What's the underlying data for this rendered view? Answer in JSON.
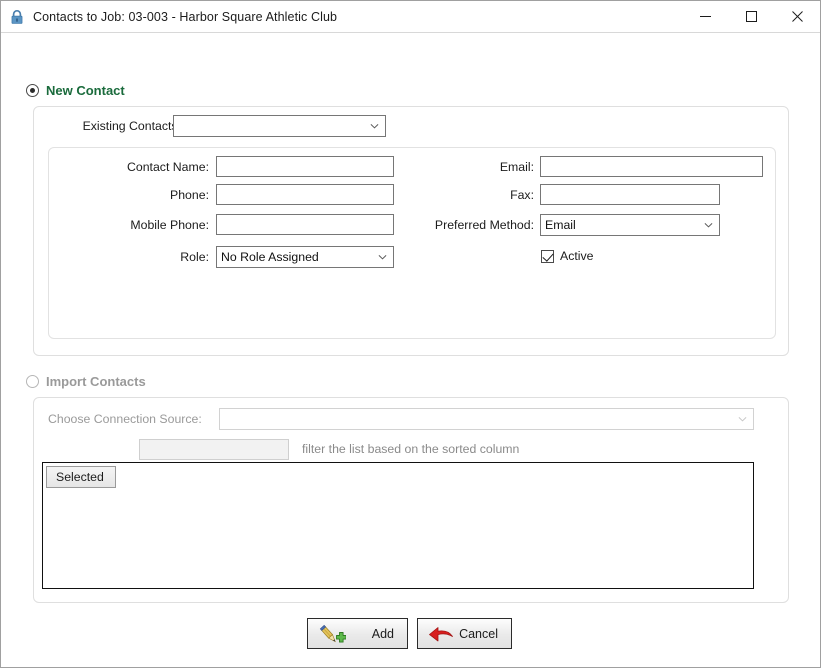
{
  "window": {
    "title": "Contacts to Job: 03-003 - Harbor Square Athletic Club",
    "lock_icon": "lock-icon",
    "controls": {
      "minimize": "—",
      "maximize": "☐",
      "close": "✕"
    }
  },
  "new_contact": {
    "radio_label": "New Contact",
    "selected": true,
    "existing_contacts_label": "Existing Contacts:",
    "existing_contacts_value": "",
    "fields": {
      "contact_name_label": "Contact Name:",
      "contact_name_value": "",
      "phone_label": "Phone:",
      "phone_value": "",
      "mobile_phone_label": "Mobile Phone:",
      "mobile_phone_value": "",
      "role_label": "Role:",
      "role_value": "No Role Assigned",
      "email_label": "Email:",
      "email_value": "",
      "fax_label": "Fax:",
      "fax_value": "",
      "preferred_method_label": "Preferred Method:",
      "preferred_method_value": "Email",
      "active_label": "Active",
      "active_checked": true
    }
  },
  "import_contacts": {
    "radio_label": "Import Contacts",
    "selected": false,
    "connection_source_label": "Choose Connection Source:",
    "connection_source_value": "",
    "filter_value": "",
    "filter_hint": "filter the list based on the sorted column",
    "grid": {
      "columns": [
        "Selected"
      ],
      "rows": []
    }
  },
  "footer": {
    "add_label": "Add",
    "add_icon": "pen-add-icon",
    "cancel_label": "Cancel",
    "cancel_icon": "red-arrow-icon"
  },
  "colors": {
    "accent_green": "#1a6b3c",
    "lock_blue": "#2f6ea5",
    "cancel_red": "#d81f1f",
    "add_green": "#4aa83c"
  }
}
